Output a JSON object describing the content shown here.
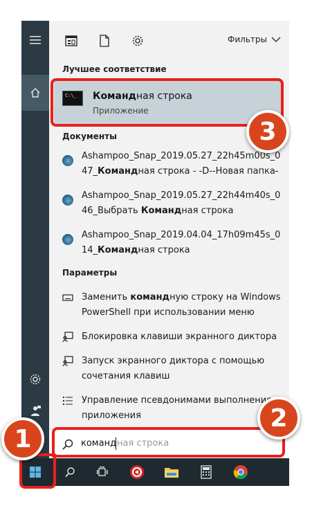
{
  "toolbar": {
    "filters_label": "Фильтры"
  },
  "best_match": {
    "section_title": "Лучшее соответствие",
    "name_bold": "Команд",
    "name_rest": "ная строка",
    "type": "Приложение",
    "icon_text": "C:\\_"
  },
  "documents": {
    "section_title": "Документы",
    "items": [
      {
        "line1": "Ashampoo_Snap_2019.05.27_22h45m00s_0",
        "line2_pre": "47_",
        "line2_bold": "Команд",
        "line2_post": "ная строка - -D--Новая папка-"
      },
      {
        "line1": "Ashampoo_Snap_2019.05.27_22h44m40s_0",
        "line2_pre": "46_Выбрать ",
        "line2_bold": "Команд",
        "line2_post": "ная строка"
      },
      {
        "line1": "Ashampoo_Snap_2019.04.04_17h09m45s_0",
        "line2_pre": "14_",
        "line2_bold": "Команд",
        "line2_post": "ная строка"
      }
    ]
  },
  "settings": {
    "section_title": "Параметры",
    "items": [
      {
        "pre": "Заменить ",
        "bold": "команд",
        "post": "ную строку на Windows PowerShell при использовании меню",
        "icon": "keyboard-icon"
      },
      {
        "pre": "Блокировка клавиши экранного диктора",
        "bold": "",
        "post": "",
        "icon": "narrator-icon"
      },
      {
        "pre": "Запуск экранного диктора с помощью сочетания клавиш",
        "bold": "",
        "post": "",
        "icon": "narrator-icon"
      },
      {
        "pre": "Управление псевдонимами выполнения приложения",
        "bold": "",
        "post": "",
        "icon": "list-icon"
      }
    ]
  },
  "search": {
    "typed": "команд",
    "hint": "ная строка"
  },
  "badges": {
    "one": "1",
    "two": "2",
    "three": "3"
  },
  "colors": {
    "highlight": "#e8201b",
    "badge": "#d8451c",
    "rail": "#2b3a43",
    "selection": "#c7d2d8"
  }
}
